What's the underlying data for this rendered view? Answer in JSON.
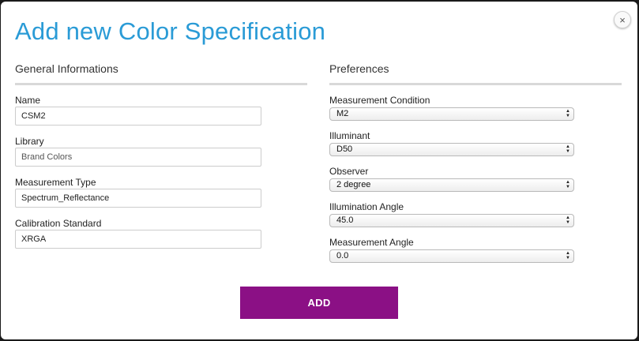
{
  "dialog": {
    "title": "Add new Color Specification",
    "close_label": "×"
  },
  "general": {
    "heading": "General Informations",
    "fields": [
      {
        "label": "Name",
        "value": "CSM2"
      },
      {
        "label": "Library",
        "value": "Brand Colors"
      },
      {
        "label": "Measurement Type",
        "value": "Spectrum_Reflectance"
      },
      {
        "label": "Calibration Standard",
        "value": "XRGA"
      }
    ]
  },
  "preferences": {
    "heading": "Preferences",
    "selects": [
      {
        "label": "Measurement Condition",
        "value": "M2"
      },
      {
        "label": "Illuminant",
        "value": "D50"
      },
      {
        "label": "Observer",
        "value": "2 degree"
      },
      {
        "label": "Illumination Angle",
        "value": "45.0"
      },
      {
        "label": "Measurement Angle",
        "value": "0.0"
      }
    ]
  },
  "footer": {
    "add_label": "ADD"
  },
  "colors": {
    "title": "#2a9bd6",
    "add_button": "#8b1085"
  }
}
